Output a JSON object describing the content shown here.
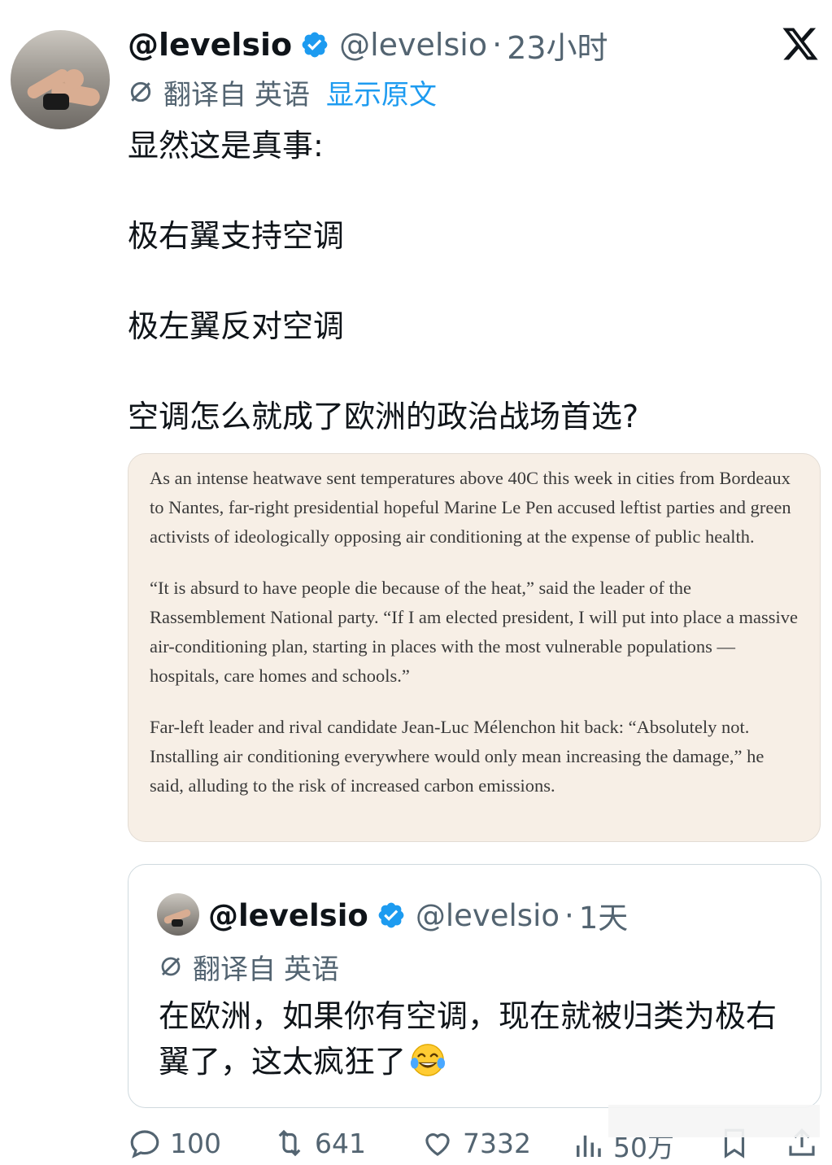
{
  "tweet": {
    "display_name": "@levelsio",
    "handle": "@levelsio",
    "separator": "·",
    "time": "23小时",
    "translate_label": "翻译自",
    "translate_lang": "英语",
    "show_original": "显示原文",
    "lines": [
      "显然这是真事:",
      "极右翼支持空调",
      "极左翼反对空调",
      "空调怎么就成了欧洲的政治战场首选?"
    ]
  },
  "article_card": {
    "paragraphs": [
      "As an intense heatwave sent temperatures above 40C this week in cities from Bordeaux to Nantes, far-right presidential hopeful Marine Le Pen accused leftist parties and green activists of ideologically opposing air conditioning at the expense of public health.",
      "“It is absurd to have people die because of the heat,” said the leader of the Rassemblement National party. “If I am elected president, I will put into place a massive air-conditioning plan, starting in places with the most vulnerable populations — hospitals, care homes and schools.”",
      "Far-left leader and rival candidate Jean-Luc Mélenchon hit back: “Absolutely not. Installing air conditioning everywhere would only mean increasing the damage,” he said, alluding to the risk of increased carbon emissions."
    ]
  },
  "quoted_tweet": {
    "display_name": "@levelsio",
    "handle": "@levelsio",
    "separator": "·",
    "time": "1天",
    "translate_label": "翻译自",
    "translate_lang": "英语",
    "text": "在欧洲，如果你有空调，现在就被归类为极右翼了，这太疯狂了",
    "emoji": "face-with-tears-of-joy"
  },
  "actions": {
    "replies": "100",
    "retweets": "641",
    "likes": "7332",
    "views": "50万"
  },
  "icons": {
    "verified": "verified-badge-icon",
    "x_logo": "x-logo-icon",
    "translate": "translate-icon",
    "reply": "reply-icon",
    "retweet": "retweet-icon",
    "like": "heart-icon",
    "views": "views-icon",
    "bookmark": "bookmark-icon",
    "share": "share-icon"
  },
  "colors": {
    "link_blue": "#1d9bf0",
    "secondary_text": "#536471",
    "card_bg": "#f7efe6"
  }
}
